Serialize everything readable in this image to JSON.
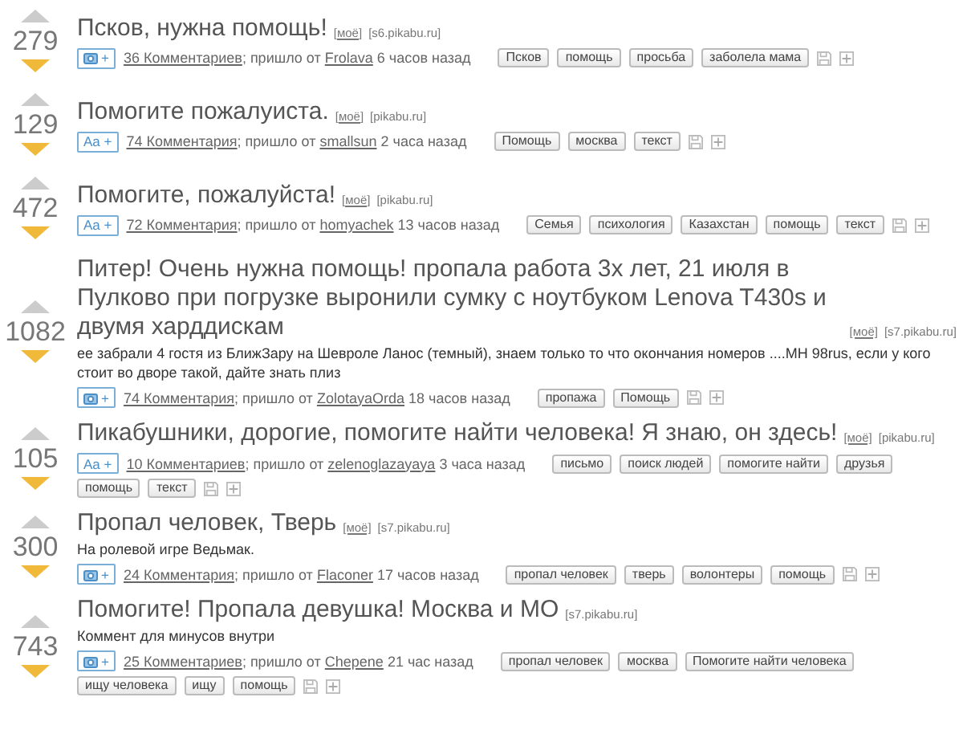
{
  "posts": [
    {
      "score": "279",
      "title": "Псков, нужна помощь!",
      "mine": "[моё]",
      "domain": "[s6.pikabu.ru]",
      "badge": {
        "kind": "photo",
        "label": "+"
      },
      "comments": "36 Комментариев",
      "via": "; пришло от",
      "author": "Frolava",
      "time": "6 часов назад",
      "tags": [
        "Псков",
        "помощь",
        "просьба",
        "заболела мама"
      ]
    },
    {
      "score": "129",
      "title": "Помогите пожалуиста.",
      "mine": "[моё]",
      "domain": "[pikabu.ru]",
      "badge": {
        "kind": "text",
        "label": "Aa +"
      },
      "comments": "74 Комментария",
      "via": "; пришло от",
      "author": "smallsun",
      "time": "2 часа назад",
      "tags": [
        "Помощь",
        "москва",
        "текст"
      ]
    },
    {
      "score": "472",
      "title": "Помогите, пожалуйста!",
      "mine": "[моё]",
      "domain": "[pikabu.ru]",
      "badge": {
        "kind": "text",
        "label": "Aa +"
      },
      "comments": "72 Комментария",
      "via": "; пришло от",
      "author": "homyachek",
      "time": "13 часов назад",
      "tags": [
        "Семья",
        "психология",
        "Казахстан",
        "помощь",
        "текст"
      ]
    },
    {
      "score": "1082",
      "title": "Питер! Очень нужна помощь! пропала работа 3х лет, 21 июля в Пулково при погрузке выронили сумку с ноутбуком Lenova T430s и двумя харддискам",
      "mine": "[моё]",
      "domain": "[s7.pikabu.ru]",
      "description": "ее забрали 4 гостя из БлижЗару на Шевроле Ланос (темный), знаем только то что окончания номеров ....МН 98rus, если у кого стоит во дворе такой, дайте знать плиз",
      "badge": {
        "kind": "photo",
        "label": "+"
      },
      "comments": "74 Комментария",
      "via": "; пришло от",
      "author": "ZolotayaOrda",
      "time": "18 часов назад",
      "tags": [
        "пропажа",
        "Помощь"
      ]
    },
    {
      "score": "105",
      "title": "Пикабушники, дорогие, помогите найти человека! Я знаю, он здесь!",
      "mine": "[моё]",
      "domain": "[pikabu.ru]",
      "badge": {
        "kind": "text",
        "label": "Aa +"
      },
      "comments": "10 Комментариев",
      "via": "; пришло от",
      "author": "zelenoglazayaya",
      "time": "3 часа назад",
      "tags": [
        "письмо",
        "поиск людей",
        "помогите найти",
        "друзья",
        "помощь",
        "текст"
      ]
    },
    {
      "score": "300",
      "title": "Пропал человек, Тверь",
      "mine": "[моё]",
      "domain": "[s7.pikabu.ru]",
      "description": "На ролевой игре Ведьмак.",
      "badge": {
        "kind": "photo",
        "label": "+"
      },
      "comments": "24 Комментария",
      "via": "; пришло от",
      "author": "Flaconer",
      "time": "17 часов назад",
      "tags": [
        "пропал человек",
        "тверь",
        "волонтеры",
        "помощь"
      ]
    },
    {
      "score": "743",
      "title": "Помогите! Пропала девушка! Москва и МО",
      "domain": "[s7.pikabu.ru]",
      "description": "Коммент для минусов внутри",
      "badge": {
        "kind": "photo",
        "label": "+"
      },
      "comments": "25 Комментариев",
      "via": "; пришло от",
      "author": "Chepene",
      "time": "21 час назад",
      "tags": [
        "пропал человек",
        "москва",
        "Помогите найти человека",
        "ищу человека",
        "ищу",
        "помощь"
      ]
    }
  ]
}
